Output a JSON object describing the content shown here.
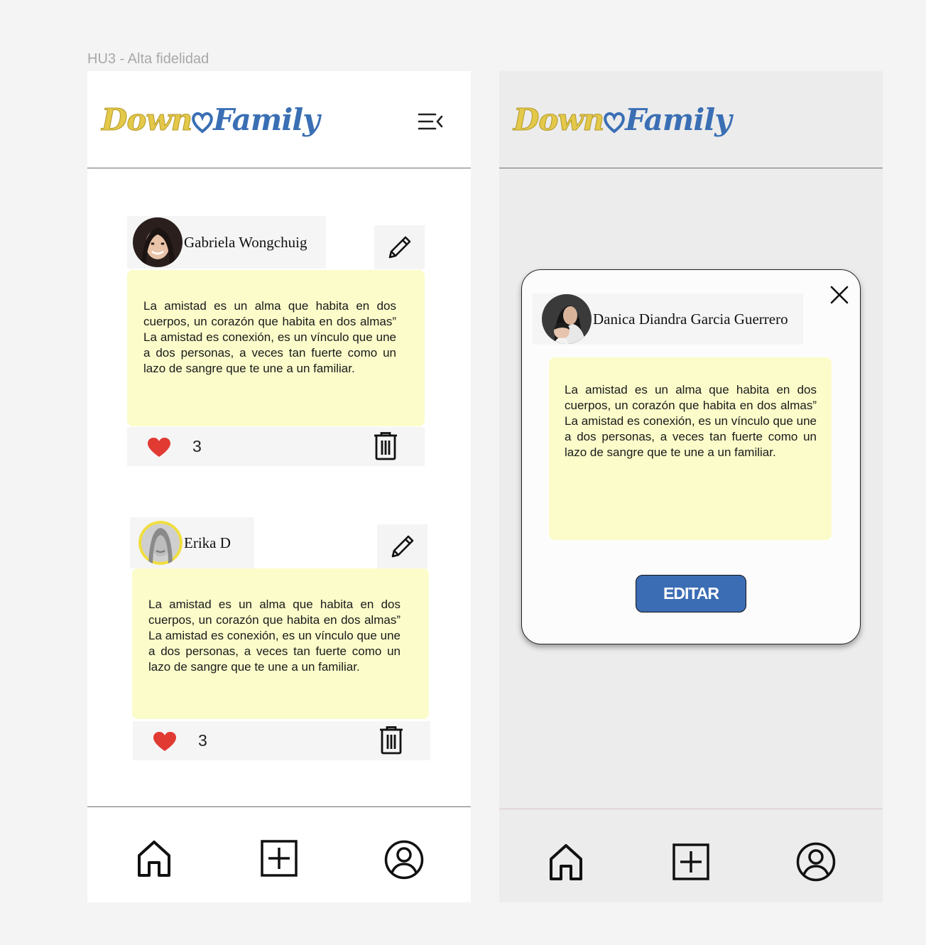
{
  "canvas": {
    "title": "HU3 - Alta fidelidad"
  },
  "brand": {
    "down": "Down",
    "family": "Family"
  },
  "feed": {
    "posts": [
      {
        "author": "Gabriela Wongchuig",
        "text": "La amistad es un alma que habita en dos cuerpos, un corazón que habita en dos almas” La amistad es conexión, es un vínculo que une a dos personas, a veces tan fuerte como un lazo de sangre que te une a un familiar.",
        "likes": "3"
      },
      {
        "author": "Erika D",
        "text": "La amistad es un alma que habita en dos cuerpos, un corazón que habita en dos almas” La amistad es conexión, es un vínculo que une a dos personas, a veces tan fuerte como un lazo de sangre que te une a un familiar.",
        "likes": "3"
      }
    ]
  },
  "modal": {
    "author": "Danica Diandra Garcia Guerrero",
    "text": "La amistad es un alma que habita en dos cuerpos, un corazón que habita en dos almas” La amistad es conexión, es un vínculo que une a dos personas, a veces tan fuerte como un lazo de sangre que te une a un familiar.",
    "button_label": "EDITAR"
  },
  "icons": {
    "menu": "menu-collapse-icon",
    "edit": "pencil-icon",
    "like": "heart-icon",
    "delete": "trash-icon",
    "close": "close-icon",
    "home": "home-icon",
    "add": "add-square-icon",
    "profile": "user-circle-icon"
  },
  "colors": {
    "note_bg": "#fbfcca",
    "like": "#e03a33",
    "button": "#3b6db4",
    "logo_gold": "#e3c84a",
    "logo_blue": "#3a6fb4"
  }
}
